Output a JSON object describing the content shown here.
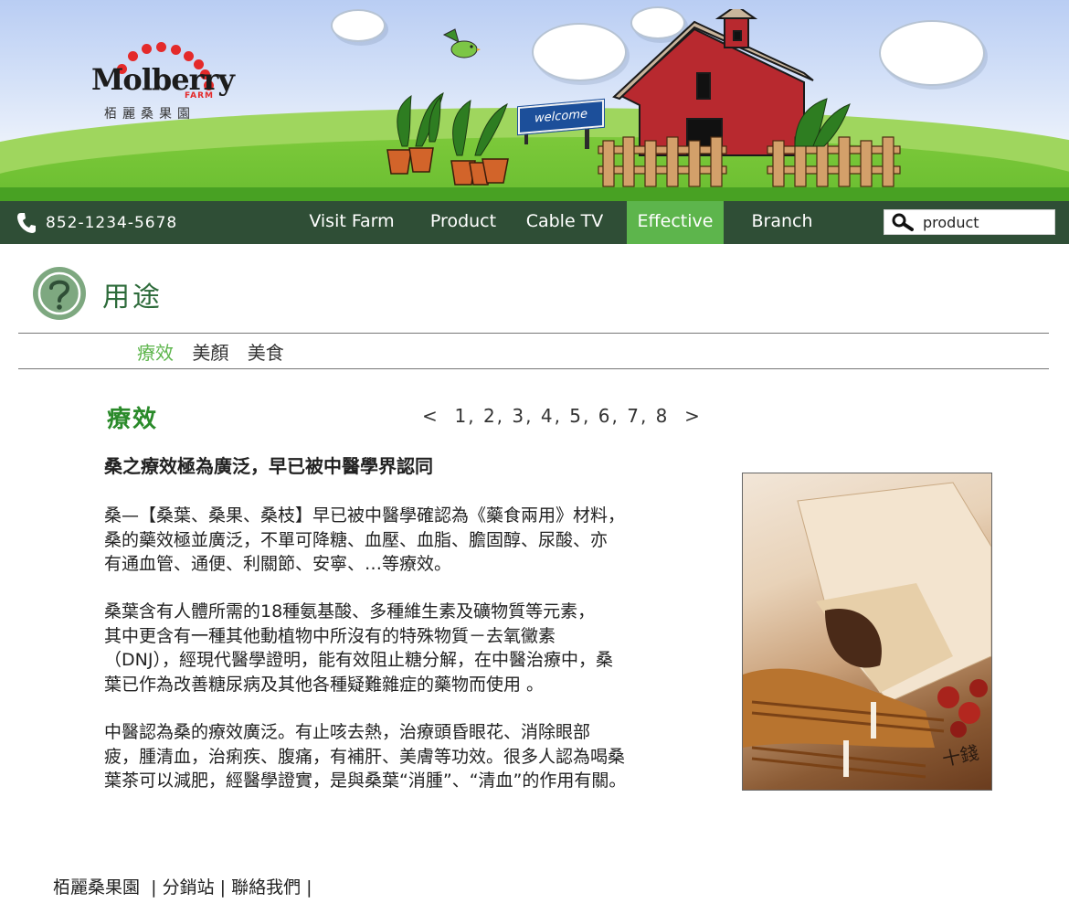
{
  "brand": {
    "logo_text": "Molberry",
    "logo_sub": "FARM",
    "logo_chinese": "栢麗桑果園"
  },
  "banner": {
    "welcome_sign": "welcome"
  },
  "header": {
    "phone": "852-1234-5678",
    "nav": [
      {
        "label": "Visit Farm"
      },
      {
        "label": "Product"
      },
      {
        "label": "Cable TV"
      },
      {
        "label": "Effective",
        "active": true
      },
      {
        "label": "Branch"
      }
    ],
    "search": {
      "value": "product"
    }
  },
  "section": {
    "title": "用途",
    "tabs": [
      {
        "label": "療效",
        "active": true
      },
      {
        "label": "美顏"
      },
      {
        "label": "美食"
      }
    ]
  },
  "content": {
    "heading": "療效",
    "pager": {
      "prev": "<",
      "pages": [
        "1",
        "2",
        "3",
        "4",
        "5",
        "6",
        "7",
        "8"
      ],
      "next": ">"
    },
    "lead": "桑之療效極為廣泛，早已被中醫學界認同",
    "paragraphs": [
      [
        "桑—【桑葉、桑果、桑枝】早已被中醫學確認為《藥食兩用》材料，",
        "桑的藥效極並廣泛，不單可降糖、血壓、血脂、膽固醇、尿酸、亦",
        "有通血管、通便、利關節、安寧、…等療效。"
      ],
      [
        "桑葉含有人體所需的18種氨基酸、多種維生素及礦物質等元素，",
        "其中更含有一種其他動植物中所沒有的特殊物質－去氧黴素",
        "（DNJ），經現代醫學證明，能有效阻止糖分解，在中醫治療中，桑",
        "葉已作為改善糖尿病及其他各種疑難雜症的藥物而使用 。"
      ],
      [
        "中醫認為桑的療效廣泛。有止咳去熱，治療頭昏眼花、消除眼部",
        "疲，腫清血，治痢疾、腹痛，有補肝、美膚等功效。很多人認為喝桑",
        "葉茶可以減肥，經醫學證實，是與桑葉“消腫”、“清血”的作用有關。"
      ]
    ],
    "photo_caption": "十錢"
  },
  "footer": {
    "links": [
      "栢麗桑果園",
      "分銷站",
      "聯絡我們"
    ]
  },
  "colors": {
    "nav_bg": "#2f4e36",
    "nav_active": "#5db54c",
    "heading_green": "#2a8a2a",
    "title_green": "#2d6b3a"
  }
}
